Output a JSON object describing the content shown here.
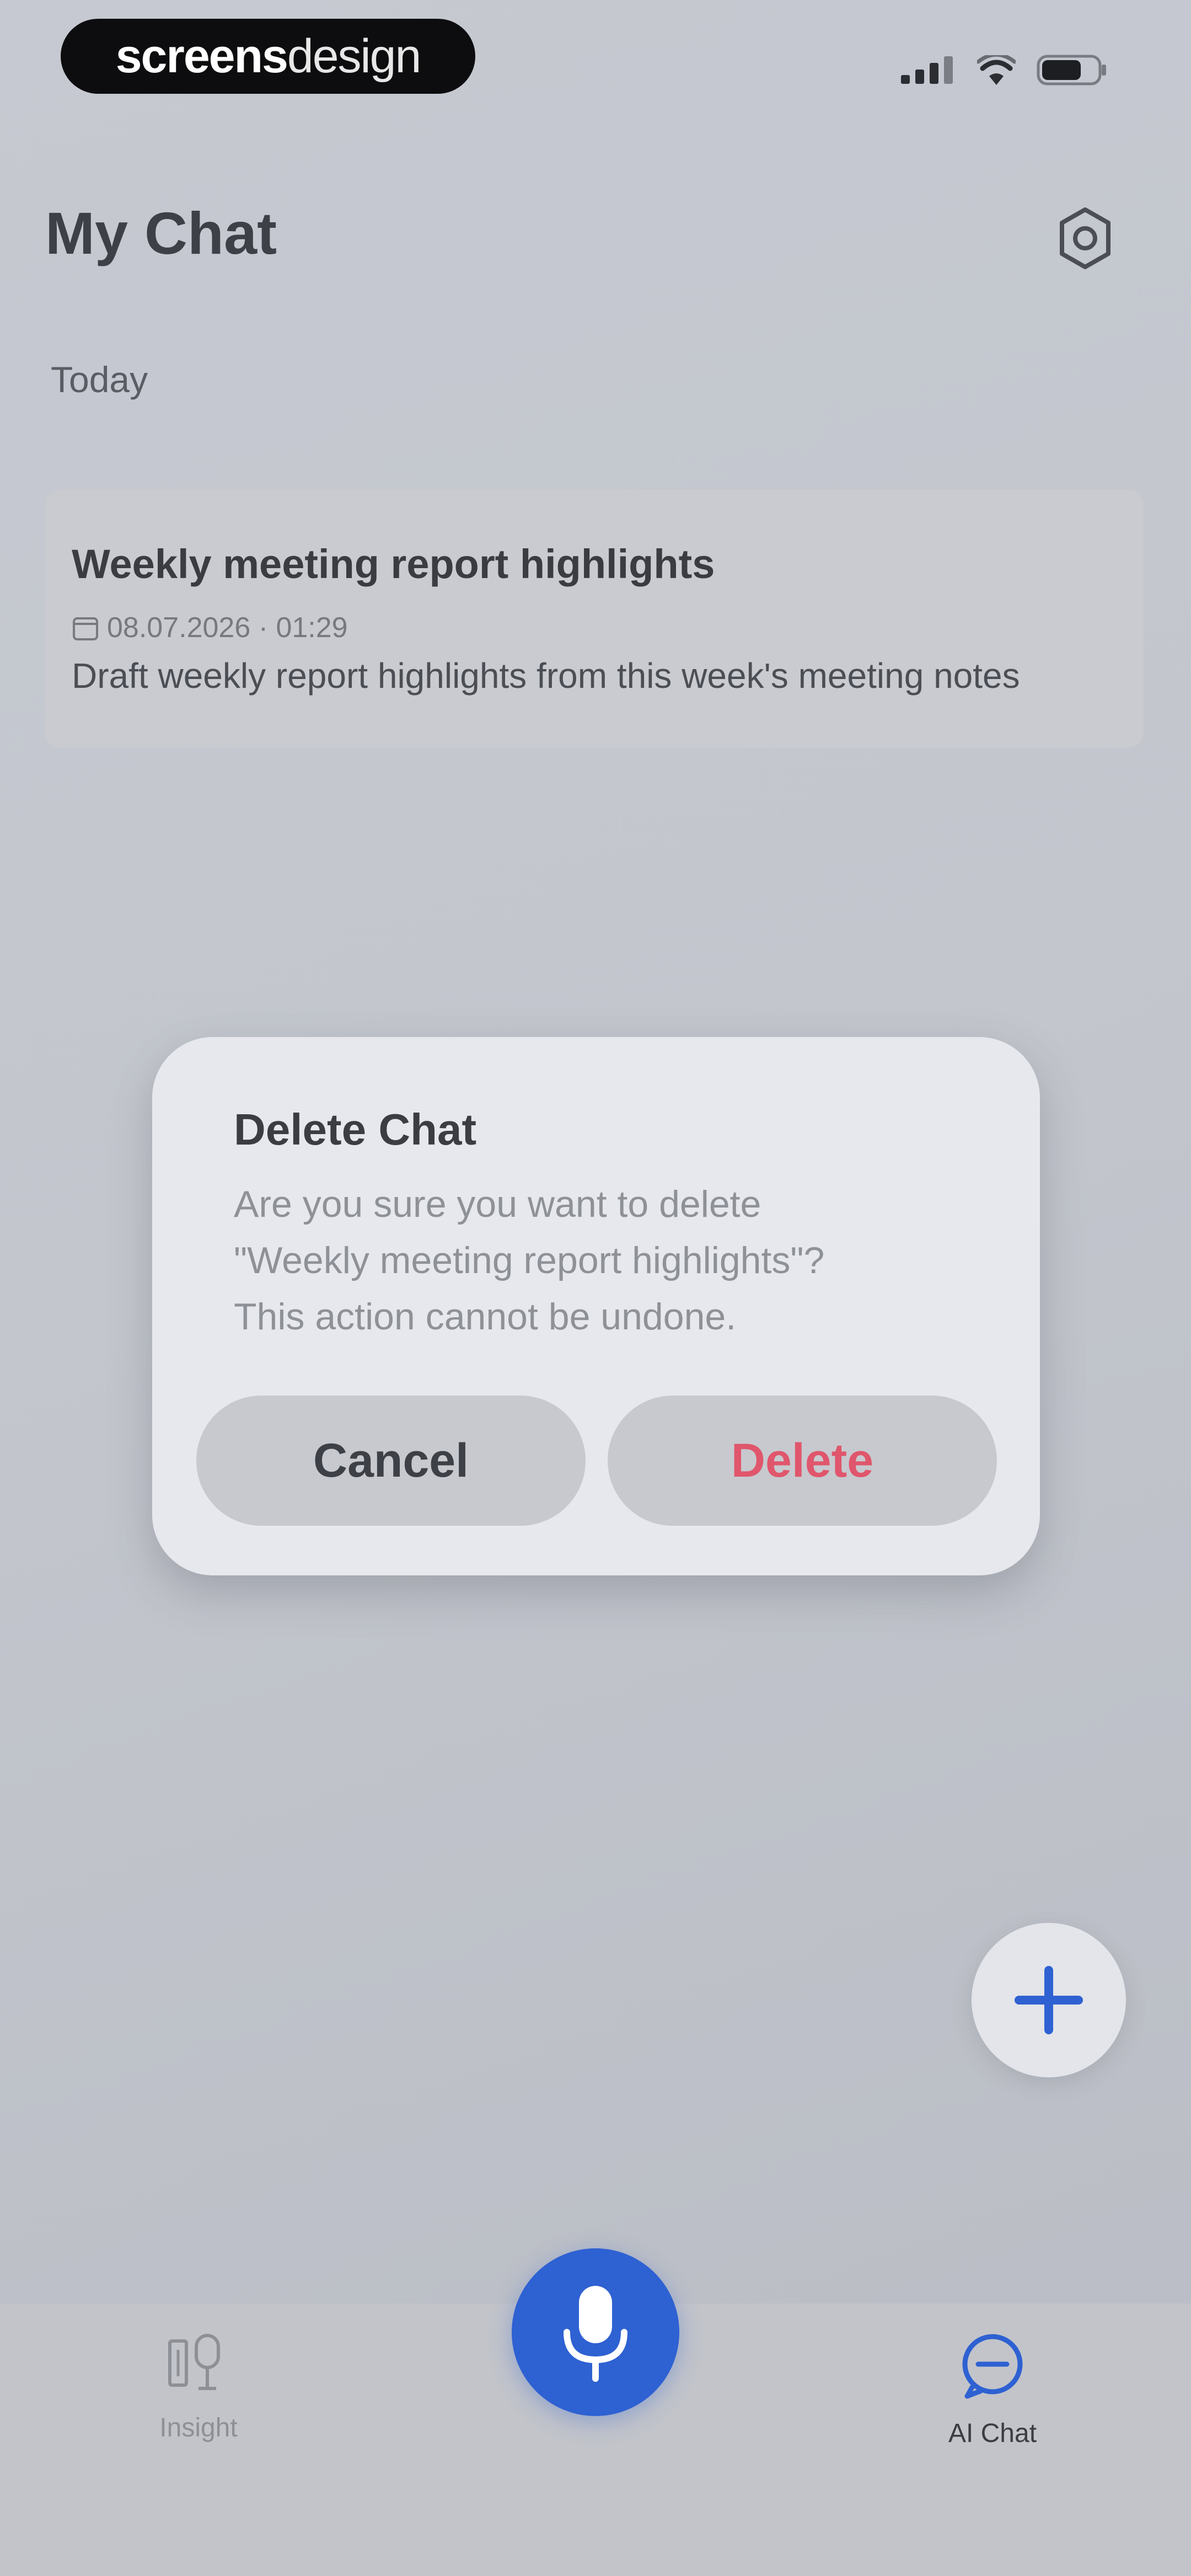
{
  "status_bar": {
    "brand_bold": "screens",
    "brand_light": "design"
  },
  "header": {
    "title": "My Chat"
  },
  "section": {
    "label": "Today"
  },
  "chat_item": {
    "title": "Weekly meeting report highlights",
    "meta": "08.07.2026 · 01:29",
    "preview": "Draft weekly report highlights from this week's meeting notes"
  },
  "dialog": {
    "title": "Delete Chat",
    "message_line1": "Are you sure you want to delete",
    "message_line2": "\"Weekly meeting report highlights\"?",
    "message_line3": "This action cannot be undone.",
    "cancel_label": "Cancel",
    "delete_label": "Delete"
  },
  "bottom_nav": {
    "insight_label": "Insight",
    "aichat_label": "AI Chat"
  },
  "colors": {
    "accent": "#2e61d2",
    "danger": "#e0566c"
  },
  "icons": [
    "signal-icon",
    "wifi-icon",
    "battery-icon",
    "gear-icon",
    "calendar-icon",
    "plus-icon",
    "microphone-icon",
    "insight-icon",
    "chat-bubble-icon"
  ]
}
